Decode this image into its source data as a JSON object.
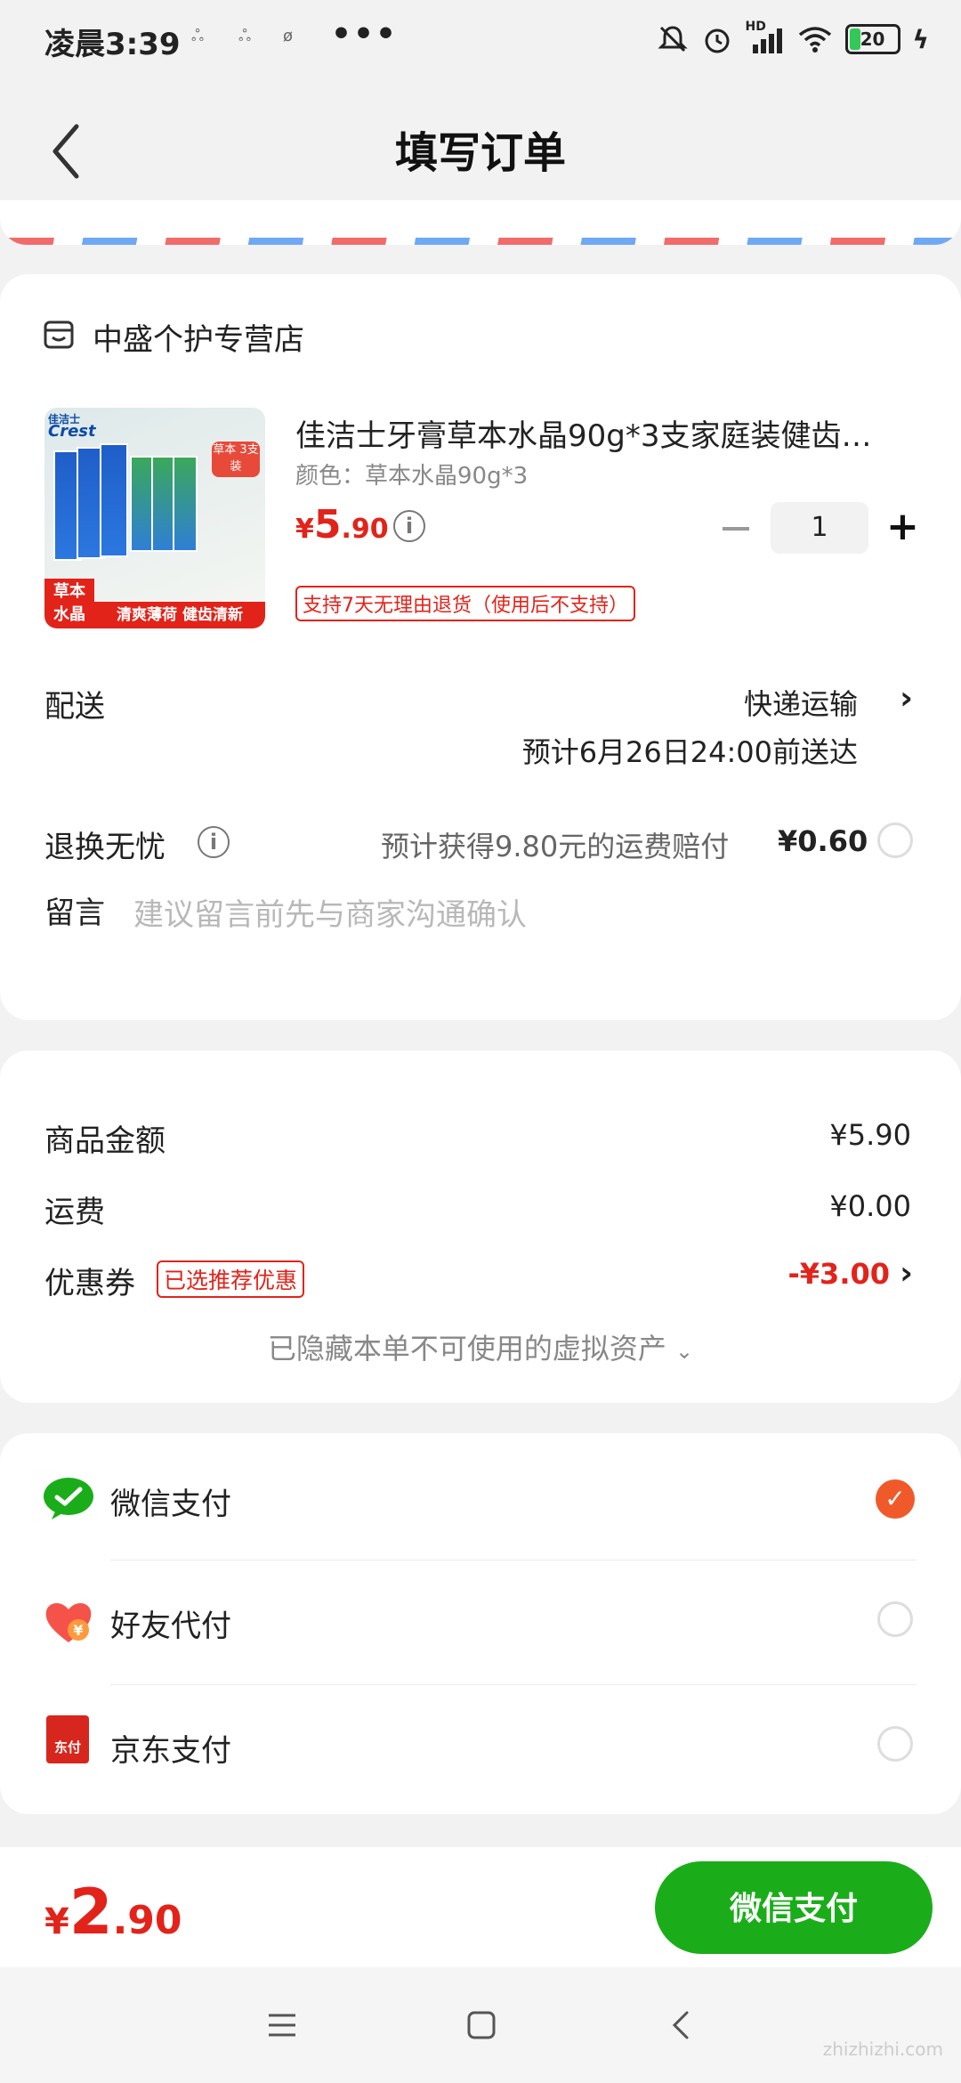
{
  "status": {
    "time": "凌晨3:39",
    "more": "•••",
    "battery": "20",
    "network": "HD"
  },
  "header": {
    "title": "填写订单"
  },
  "shop": {
    "name": "中盛个护专营店",
    "product": {
      "title": "佳洁士牙膏草本水晶90g*3支家庭装健齿…",
      "spec": "颜色：草本水晶90g*3",
      "price_currency": "¥",
      "price_int": "5",
      "price_dec": ".90",
      "quantity": "1",
      "return_policy": "支持7天无理由退货（使用后不支持）",
      "image_text": {
        "brand": "佳洁士",
        "brand_en": "Crest",
        "badge": "草本 3支装",
        "corner": "草本 水晶",
        "slogan": "清爽薄荷 健齿清新"
      }
    },
    "delivery": {
      "label": "配送",
      "method": "快递运输",
      "eta": "预计6月26日24:00前送达"
    },
    "return_worry": {
      "label": "退换无忧",
      "desc": "预计获得9.80元的运费赔付",
      "price": "¥0.60"
    },
    "message": {
      "label": "留言",
      "placeholder": "建议留言前先与商家沟通确认"
    }
  },
  "summary": {
    "goods_label": "商品金额",
    "goods_value": "¥5.90",
    "shipping_label": "运费",
    "shipping_value": "¥0.00",
    "coupon_label": "优惠券",
    "coupon_tag": "已选推荐优惠",
    "coupon_value": "-¥3.00",
    "hidden_assets": "已隐藏本单不可使用的虚拟资产"
  },
  "payment": {
    "options": [
      {
        "label": "微信支付",
        "selected": true
      },
      {
        "label": "好友代付",
        "selected": false
      },
      {
        "label": "京东支付",
        "selected": false
      }
    ],
    "jd_icon_text": "东付",
    "friend_icon_text": "¥"
  },
  "footer": {
    "total_currency": "¥",
    "total_int": "2",
    "total_dec": ".90",
    "pay_button": "微信支付"
  },
  "watermark": "zhizhizhi.com",
  "colors": {
    "price_red": "#e2231a",
    "wechat_green": "#1aad19",
    "check_orange": "#f05a2a"
  }
}
